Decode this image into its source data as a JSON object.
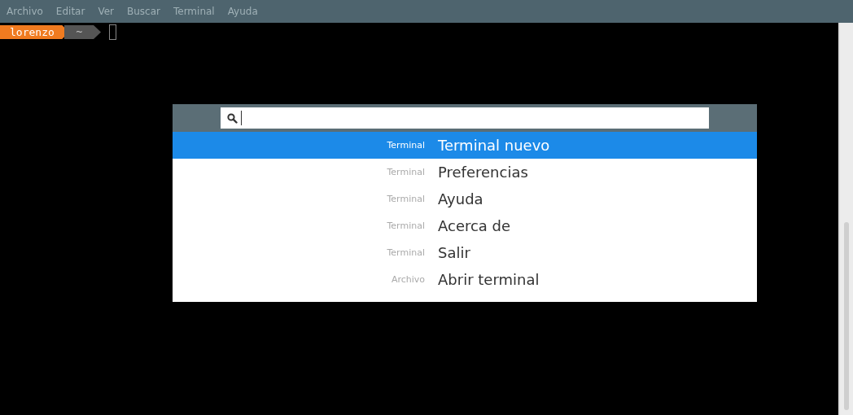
{
  "menu": [
    "Archivo",
    "Editar",
    "Ver",
    "Buscar",
    "Terminal",
    "Ayuda"
  ],
  "prompt": {
    "user": "lorenzo",
    "dir": "~"
  },
  "results": [
    {
      "category": "Terminal",
      "label": "Terminal nuevo",
      "selected": true
    },
    {
      "category": "Terminal",
      "label": "Preferencias",
      "selected": false
    },
    {
      "category": "Terminal",
      "label": "Ayuda",
      "selected": false
    },
    {
      "category": "Terminal",
      "label": "Acerca de",
      "selected": false
    },
    {
      "category": "Terminal",
      "label": "Salir",
      "selected": false
    },
    {
      "category": "Archivo",
      "label": "Abrir terminal",
      "selected": false
    }
  ]
}
